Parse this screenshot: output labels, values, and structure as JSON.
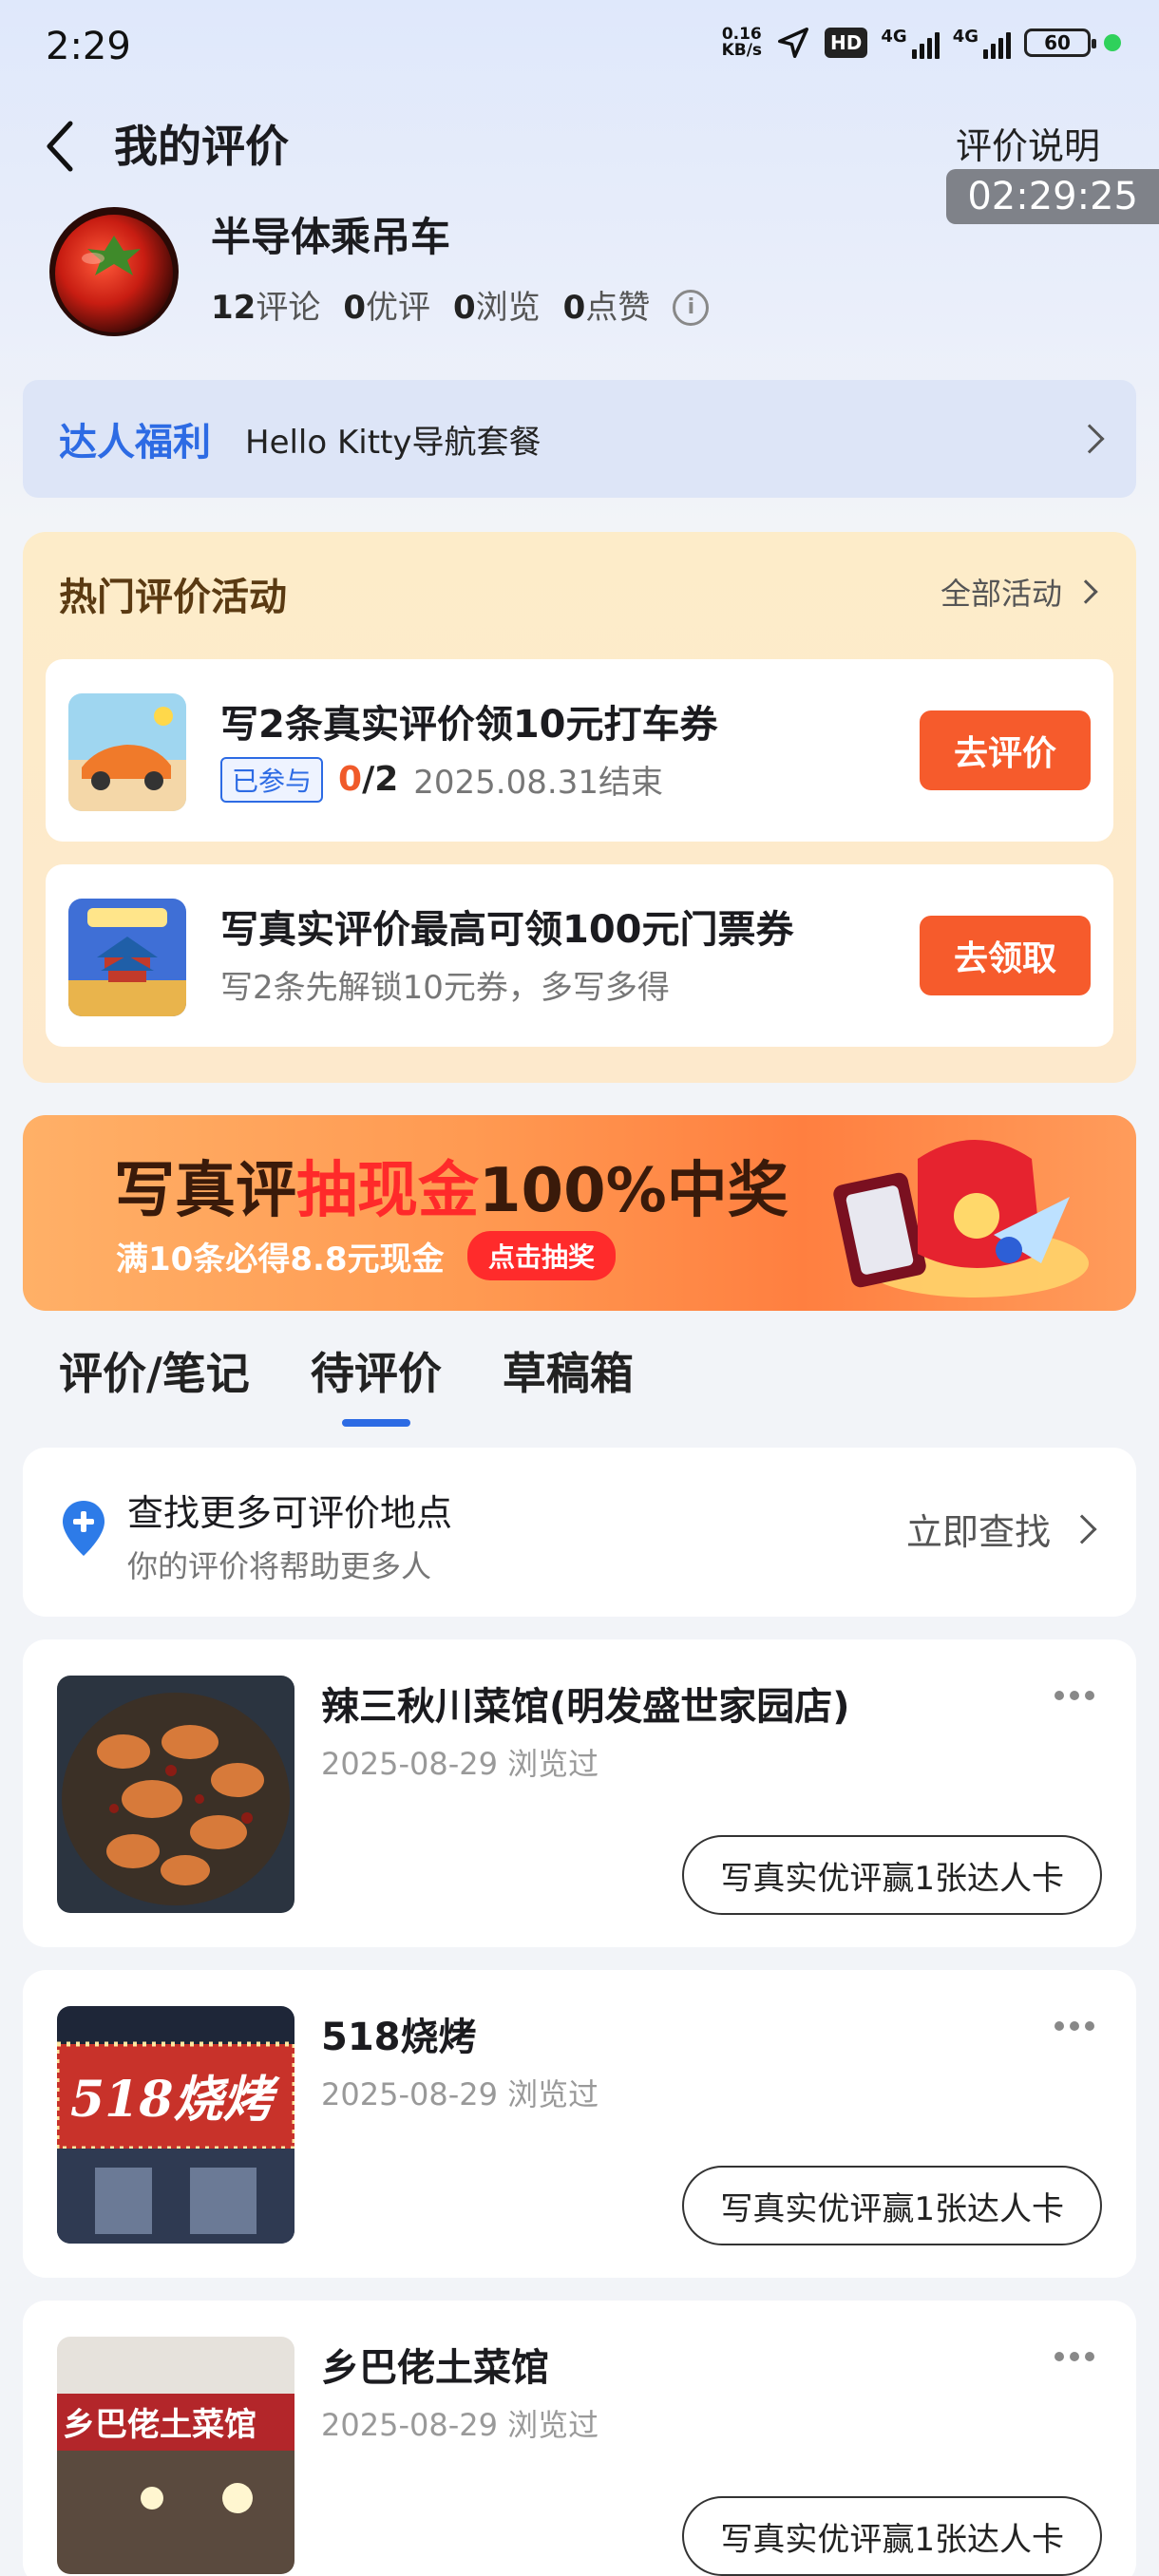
{
  "status_bar": {
    "time": "2:29",
    "net_speed_value": "0.16",
    "net_speed_unit": "KB/s",
    "hd": "HD",
    "sim1": "4G",
    "sim2": "4G",
    "battery": "60"
  },
  "header": {
    "title": "我的评价",
    "rules_link": "评价说明",
    "time_overlay": "02:29:25"
  },
  "profile": {
    "username": "半导体乘吊车",
    "stats": [
      {
        "num": "12",
        "label": "评论"
      },
      {
        "num": "0",
        "label": "优评"
      },
      {
        "num": "0",
        "label": "浏览"
      },
      {
        "num": "0",
        "label": "点赞"
      }
    ]
  },
  "benefit": {
    "label": "达人福利",
    "desc": "Hello Kitty导航套餐"
  },
  "hot": {
    "title": "热门评价活动",
    "all_link": "全部活动",
    "activities": [
      {
        "title": "写2条真实评价领10元打车券",
        "badge": "已参与",
        "progress_done": "0",
        "progress_total": "/2",
        "end": "2025.08.31结束",
        "button": "去评价"
      },
      {
        "title": "写真实评价最高可领100元门票券",
        "subtitle": "写2条先解锁10元券，多写多得",
        "button": "去领取"
      }
    ]
  },
  "banner": {
    "title_a": "写真评",
    "title_hl": "抽现金",
    "title_b": "100%中奖",
    "subtitle": "满10条必得8.8元现金",
    "button": "点击抽奖"
  },
  "tabs": [
    {
      "label": "评价/笔记"
    },
    {
      "label": "待评价"
    },
    {
      "label": "草稿箱"
    }
  ],
  "find_more": {
    "title": "查找更多可评价地点",
    "subtitle": "你的评价将帮助更多人",
    "link": "立即查找"
  },
  "places": [
    {
      "name": "辣三秋川菜馆(明发盛世家园店)",
      "date": "2025-08-29 浏览过",
      "button": "写真实优评赢1张达人卡"
    },
    {
      "name": "518烧烤",
      "date": "2025-08-29 浏览过",
      "button": "写真实优评赢1张达人卡",
      "sign_text": "518烧烤"
    },
    {
      "name": "乡巴佬土菜馆",
      "date": "2025-08-29 浏览过",
      "button": "写真实优评赢1张达人卡",
      "sign_text": "乡巴佬土菜馆"
    }
  ]
}
